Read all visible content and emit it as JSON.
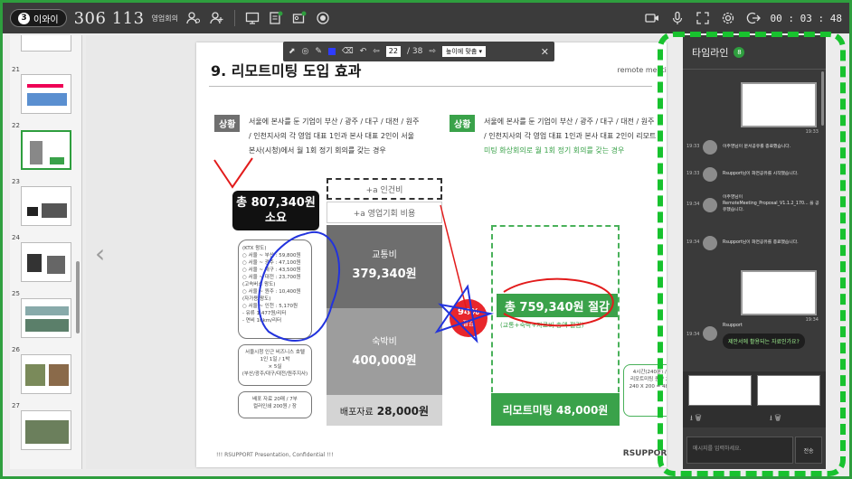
{
  "topbar": {
    "participants_count": "3",
    "participants_label": "이와이",
    "room_id": "306 113",
    "room_name": "영업회의",
    "timer": "00 : 03 : 48"
  },
  "thumbnails": [
    {
      "num": "21"
    },
    {
      "num": "22"
    },
    {
      "num": "23"
    },
    {
      "num": "24"
    },
    {
      "num": "25"
    },
    {
      "num": "26"
    },
    {
      "num": "27"
    }
  ],
  "drawbar": {
    "page_current": "22",
    "page_sep": "/ 38",
    "fit_option": "높이에 맞춤 ▾",
    "close": "✕"
  },
  "slide": {
    "title_prefix": "9. 리모트미팅 ",
    "title_bold": "도입 효과",
    "logo_text": "remote meeting",
    "left_tag": "상황",
    "left_desc_1": "서울에 본사를 둔 기업이 부산 / 광주 / 대구 / 대전 / 원주",
    "left_desc_2": "/ 인천지사의 각 영업 대표 1인과 본사 대표 2인이 서울",
    "left_desc_3": "본사(시청)에서 월 1회 정기 회의를 갖는 경우",
    "right_tag": "상황",
    "right_desc_1": "서울에 본사를 둔 기업이 부산 / 광주 / 대구 / 대전 / 원주",
    "right_desc_2": "/ 인천지사의 각 영업 대표 1인과 본사 대표 2인이 리모트",
    "right_desc_3": "미팅 화상회의로 월 1회 정기 회의를 갖는 경우",
    "labor_cost": "+a 인건비",
    "opportunity_cost": "+a 영업기회 비용",
    "transport_label": "교통비",
    "transport_value": "379,340원",
    "lodging_label": "숙박비",
    "lodging_value": "400,000원",
    "handout_label": "배포자료",
    "handout_value": "28,000원",
    "total_label_1": "총 807,340원",
    "total_label_2": "소요",
    "detail_lines": [
      "(KTX 왕도)",
      "○ 서울 ~ 부산 : 59,800원",
      "○ 서울 ~ 광주 : 47,100원",
      "○ 서울 ~ 대구 : 43,500원",
      "○ 서울 ~ 대전 : 23,700원",
      "(고속버스 왕도)",
      "○ 서울 ~ 원주 : 10,400원",
      "(자가용 왕도)",
      "○ 서울 ~ 인천 : 5,170원",
      "- 유류 1,477원/리터",
      "- 연비 10km/리터"
    ],
    "hotel_note": [
      "서울시청 인근 비즈니스 호텔",
      "1인 1일 / 1박",
      "× 5실",
      "(부산/광주/대구/대전/원주지사)"
    ],
    "print_note": [
      "배포 자료 20매 / 7부",
      "컬러인쇄 200원 / 장"
    ],
    "percent": "94%",
    "percent_sub": "절감",
    "saving_value": "총 759,340원 절감",
    "saving_sub": "(교통+숙박+자료비 총액 절감)",
    "remote_label": "리모트미팅 48,000원",
    "remote_note": [
      "4시간(240분) / 1회의",
      "리모트미팅 종량 200원 /",
      "240 X 200 = 48,000원"
    ],
    "footer": "!!! RSUPPORT Presentation, Confidential !!!",
    "footer_logo": "RSUPPORT"
  },
  "panel": {
    "title": "타임라인",
    "count": "8",
    "entries": [
      {
        "time": "19:33",
        "text": "이주영님이 문서공유를 종료했습니다."
      },
      {
        "time": "19:33",
        "text": "Rsupport님이 화면공유를 시작했습니다."
      },
      {
        "time": "19:34",
        "text": "이주영님이 RemoteMeeting_Proposal_V1.1.2_170... 을 공유했습니다."
      },
      {
        "time": "19:34",
        "text": "Rsupport님이 화면공유를 종료했습니다."
      }
    ],
    "thumb_time_1": "19:33",
    "thumb_time_2": "19:34",
    "chat_user": "Rsupport",
    "chat_time": "19:34",
    "chat_message": "제안서에 활용되는 자료인가요?",
    "input_placeholder": "메시지를 입력하세요.",
    "send_label": "전송"
  }
}
